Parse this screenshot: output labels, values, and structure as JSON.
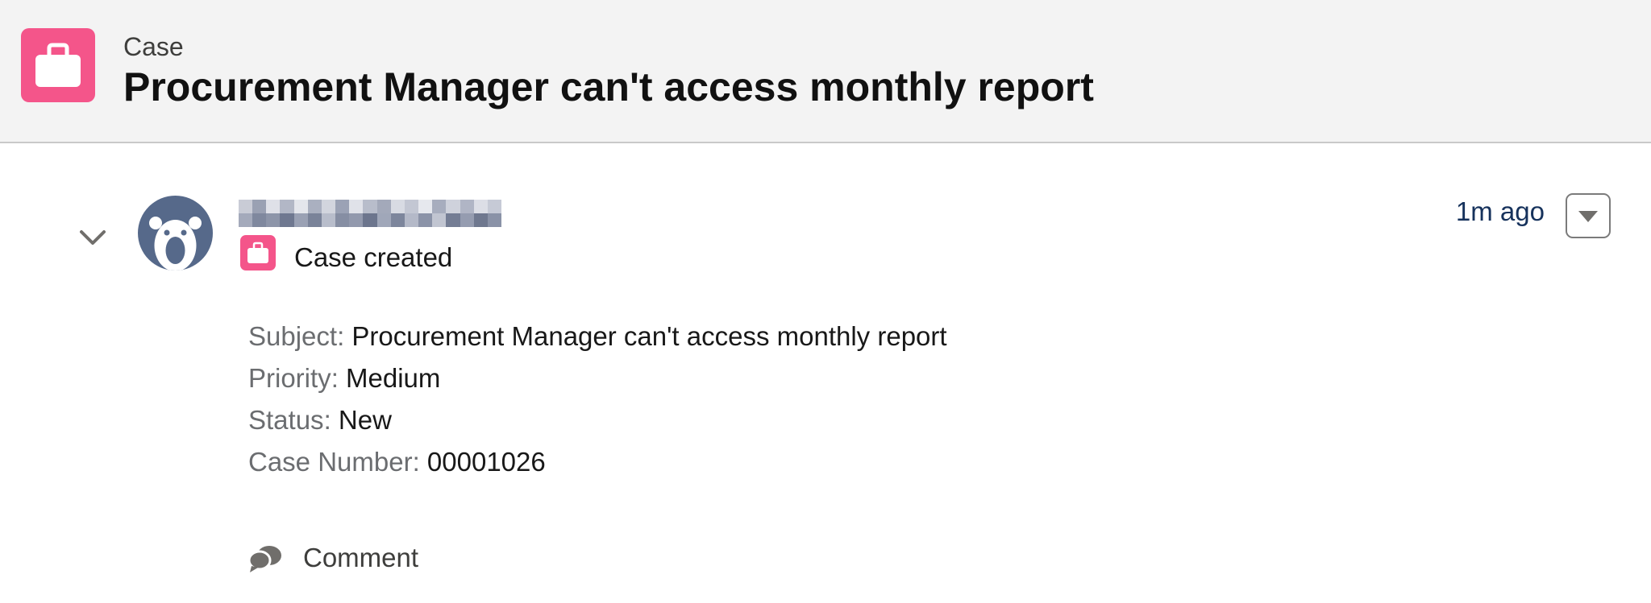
{
  "header": {
    "icon": "case-briefcase-icon",
    "icon_color": "#f4558a",
    "object_label": "Case",
    "record_title": "Procurement Manager can't access monthly report"
  },
  "feed_item": {
    "collapse_icon": "chevron-down-icon",
    "avatar_icon": "bear-avatar-icon",
    "actor_name_redacted": true,
    "event_icon": "case-briefcase-icon",
    "event_label": "Case created",
    "timestamp": "1m ago",
    "actions_menu_icon": "triangle-down-icon",
    "fields": [
      {
        "label": "Subject",
        "value": "Procurement Manager can't access monthly report"
      },
      {
        "label": "Priority",
        "value": "Medium"
      },
      {
        "label": "Status",
        "value": "New"
      },
      {
        "label": "Case Number",
        "value": "00001026"
      }
    ],
    "comment": {
      "icon": "comment-bubbles-icon",
      "label": "Comment"
    }
  },
  "colors": {
    "brand_pink": "#f4558a",
    "avatar_bg": "#56698a",
    "timestamp_text": "#16325c",
    "header_bg": "#f3f3f3"
  }
}
